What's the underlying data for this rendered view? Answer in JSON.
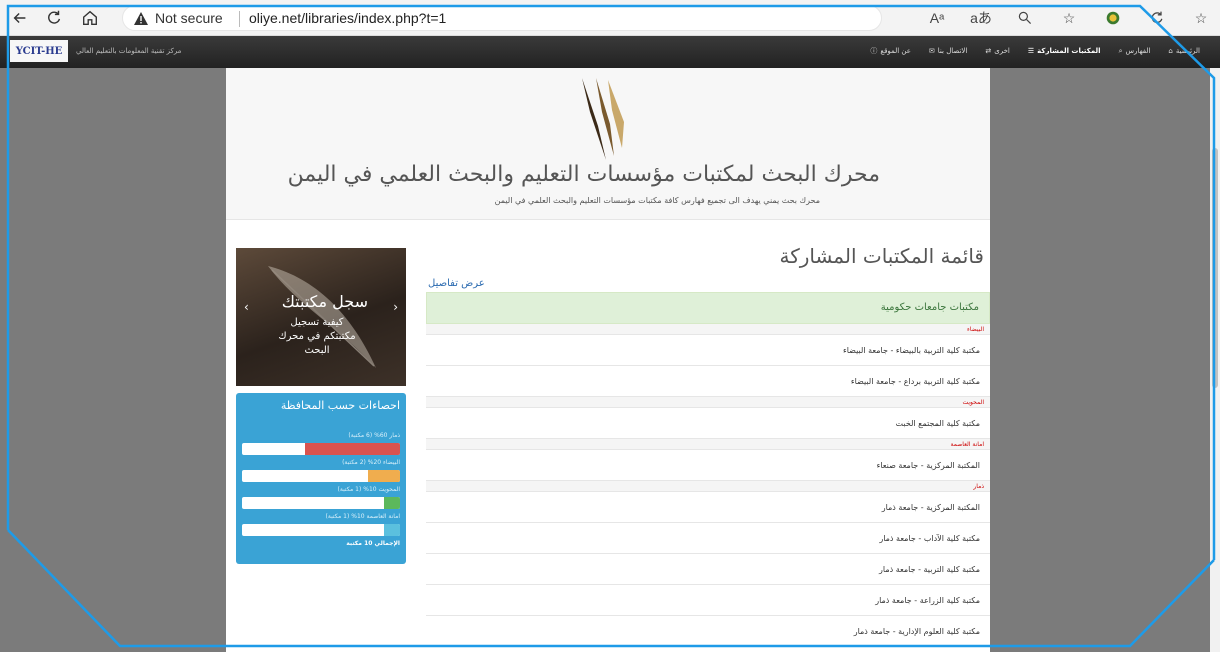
{
  "browser": {
    "not_secure_label": "Not secure",
    "url": "oliye.net/libraries/index.php?t=1",
    "read_aloud_label": "Aᵃ"
  },
  "site_nav": {
    "logo_text": "YCIT-HE",
    "org_name": "مركز تقنية المعلومات بالتعليم العالي",
    "menu": [
      {
        "label": "الرئيسية",
        "icon": "home-icon"
      },
      {
        "label": "الفهارس",
        "icon": "search-icon"
      },
      {
        "label": "المكتبات المشاركة",
        "icon": "list-icon"
      },
      {
        "label": "اخرى",
        "icon": "shuffle-icon"
      },
      {
        "label": "الاتصال بنا",
        "icon": "envelope-icon"
      },
      {
        "label": "عن الموقع",
        "icon": "info-icon"
      }
    ]
  },
  "hero": {
    "title": "محرك البحث لمكتبات مؤسسات التعليم والبحث العلمي في اليمن",
    "subtitle": "محرك بحث يمني يهدف الى تجميع فهارس كافة مكتبات مؤسسات التعليم والبحث العلمي في اليمن"
  },
  "main": {
    "title": "قائمة المكتبات المشاركة",
    "details_link": "عرض تفاصيل",
    "panel_title": "مكتبات جامعات حكومية",
    "rows": [
      {
        "type": "region",
        "label": "البيضاء"
      },
      {
        "type": "library",
        "label": "مكتبة كلية التربية بالبيضاء - جامعة البيضاء"
      },
      {
        "type": "library",
        "label": "مكتبة كلية التربية برداع - جامعة البيضاء"
      },
      {
        "type": "region",
        "label": "المحويت"
      },
      {
        "type": "library",
        "label": "مكتبة كلية المجتمع الخبت"
      },
      {
        "type": "region",
        "label": "امانة العاصمة"
      },
      {
        "type": "library",
        "label": "المكتبة المركزية - جامعة صنعاء"
      },
      {
        "type": "region",
        "label": "ذمار"
      },
      {
        "type": "library",
        "label": "المكتبة المركزية - جامعة ذمار"
      },
      {
        "type": "library",
        "label": "مكتبة كلية الآداب - جامعة ذمار"
      },
      {
        "type": "library",
        "label": "مكتبة كلية التربية - جامعة ذمار"
      },
      {
        "type": "library",
        "label": "مكتبة كلية الزراعة - جامعة ذمار"
      },
      {
        "type": "library",
        "label": "مكتبة كلية العلوم الإدارية - جامعة ذمار"
      }
    ]
  },
  "sidebar": {
    "banner": {
      "title": "سجل مكتبتك",
      "text": "كيفية تسجيل مكتبتكم في محرك البحث"
    },
    "stats": {
      "title": "احصاءات حسب المحافظة",
      "items": [
        {
          "label": "ذمار 60% (6 مكتبة)",
          "percent": 60,
          "color": "#d9534f"
        },
        {
          "label": "البيضاء 20% (2 مكتبة)",
          "percent": 20,
          "color": "#f0ad4e"
        },
        {
          "label": "المحويت 10% (1 مكتبة)",
          "percent": 10,
          "color": "#5cb85c"
        },
        {
          "label": "امانة العاصمة 10% (1 مكتبة)",
          "percent": 10,
          "color": "#5bc0de"
        }
      ],
      "total": "الإجمالي 10 مكتبة"
    }
  }
}
